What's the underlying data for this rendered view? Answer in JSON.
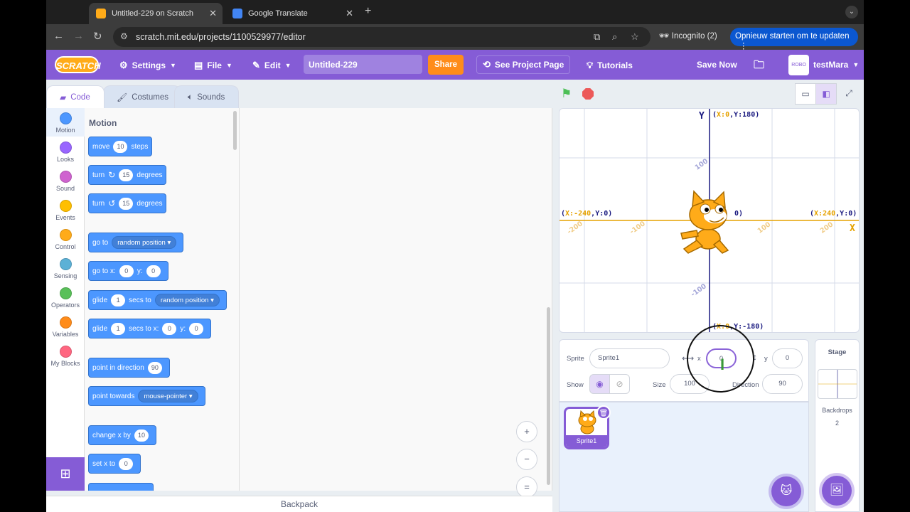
{
  "browser": {
    "tabs": [
      {
        "title": "Untitled-229 on Scratch",
        "favicon_color": "#ffab19",
        "active": true
      },
      {
        "title": "Google Translate",
        "favicon_color": "#4285f4",
        "active": false
      }
    ],
    "url": "scratch.mit.edu/projects/1100529977/editor",
    "incognito_label": "Incognito (2)",
    "restart_label": "Opnieuw starten om te updaten"
  },
  "menubar": {
    "logo": "SCRATCH",
    "settings": "Settings",
    "file": "File",
    "edit": "Edit",
    "project_title": "Untitled-229",
    "share": "Share",
    "see_project_page": "See Project Page",
    "tutorials": "Tutorials",
    "save_now": "Save Now",
    "username": "testMara",
    "avatar_text": "ROBO",
    "accent": "#855cd6"
  },
  "editor_tabs": {
    "code": "Code",
    "costumes": "Costumes",
    "sounds": "Sounds"
  },
  "categories": [
    {
      "label": "Motion",
      "color": "#4c97ff"
    },
    {
      "label": "Looks",
      "color": "#9966ff"
    },
    {
      "label": "Sound",
      "color": "#cf63cf"
    },
    {
      "label": "Events",
      "color": "#ffbf00"
    },
    {
      "label": "Control",
      "color": "#ffab19"
    },
    {
      "label": "Sensing",
      "color": "#5cb1d6"
    },
    {
      "label": "Operators",
      "color": "#59c059"
    },
    {
      "label": "Variables",
      "color": "#ff8c1a"
    },
    {
      "label": "My Blocks",
      "color": "#ff6680"
    }
  ],
  "palette": {
    "heading": "Motion",
    "blocks": {
      "move": {
        "t1": "move",
        "v1": "10",
        "t2": "steps"
      },
      "turn_right": {
        "t1": "turn",
        "v1": "15",
        "t2": "degrees"
      },
      "turn_left": {
        "t1": "turn",
        "v1": "15",
        "t2": "degrees"
      },
      "goto": {
        "t1": "go to",
        "dd": "random position"
      },
      "goto_xy": {
        "t1": "go to x:",
        "v1": "0",
        "t2": "y:",
        "v2": "0"
      },
      "glide_to": {
        "t1": "glide",
        "v1": "1",
        "t2": "secs to",
        "dd": "random position"
      },
      "glide_xy": {
        "t1": "glide",
        "v1": "1",
        "t2": "secs to x:",
        "v2": "0",
        "t3": "y:",
        "v3": "0"
      },
      "point_dir": {
        "t1": "point in direction",
        "v1": "90"
      },
      "point_towards": {
        "t1": "point towards",
        "dd": "mouse-pointer"
      },
      "change_x": {
        "t1": "change x by",
        "v1": "10"
      },
      "set_x": {
        "t1": "set x to",
        "v1": "0"
      }
    }
  },
  "workspace": {
    "backpack": "Backpack",
    "zoom_in": "+",
    "zoom_out": "−",
    "zoom_reset": "="
  },
  "stage": {
    "axis_y_label": "Y",
    "axis_x_label": "X",
    "top": {
      "x": "X:0",
      "y": "Y:180"
    },
    "bottom": {
      "x": "X:0",
      "y": "Y:-180"
    },
    "left": {
      "x": "X:-240",
      "y": "Y:0"
    },
    "right": {
      "x": "X:240",
      "y": "Y:0"
    },
    "center_frag": "0)",
    "ticks": {
      "y100": "100",
      "yneg100": "-100",
      "xneg200": "-200",
      "xneg100": "-100",
      "x100": "100",
      "x200": "200"
    },
    "x_axis_color": "#e6a200",
    "y_axis_color": "#1a1a80"
  },
  "sprite_info": {
    "sprite_label": "Sprite",
    "sprite_name": "Sprite1",
    "x_label": "x",
    "x_value": "0",
    "y_label": "y",
    "y_value": "0",
    "show_label": "Show",
    "size_label": "Size",
    "size_value": "100",
    "direction_label": "Direction",
    "direction_value": "90"
  },
  "sprites": [
    {
      "name": "Sprite1"
    }
  ],
  "stage_pane": {
    "label": "Stage",
    "backdrops_label": "Backdrops",
    "backdrops_count": "2"
  }
}
